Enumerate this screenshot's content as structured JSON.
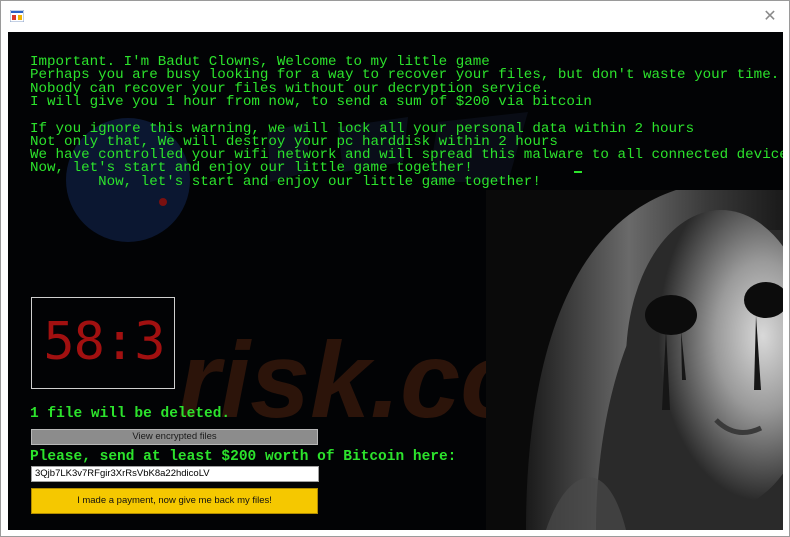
{
  "window": {
    "title": "",
    "close_glyph": "✕",
    "icon": "app-icon"
  },
  "message": {
    "lines": [
      "Important. I'm Badut Clowns, Welcome to my little game",
      "Perhaps you are busy looking for a way to recover your files, but don't waste your time.",
      "Nobody can recover your files without our decryption service.",
      "I will give you 1 hour from now, to send a sum of $200 via bitcoin",
      "",
      "If you ignore this warning, we will lock all your personal data within 2 hours",
      "Not only that, We will destroy your pc harddisk within 2 hours",
      "We have controlled your wifi network and will spread this malware to all connected devices",
      "Now, let's start and enjoy our little game together!",
      "        Now, let's start and enjoy our little game together!"
    ]
  },
  "timer": {
    "value": "58:3"
  },
  "status": {
    "deleted_text": "1 file will be deleted."
  },
  "buttons": {
    "view_label": "View encrypted files",
    "pay_label": "I made a payment, now give me back my files!"
  },
  "payment": {
    "prompt": "Please, send at least $200 worth of Bitcoin here:",
    "address": "3Qjb7LK3v7RFgir3XrRsVbK8a22hdicoLV"
  },
  "watermark": {
    "text": "risk.com"
  },
  "colors": {
    "text_green": "#2ce32c",
    "timer_red": "#a11010",
    "pay_button": "#f5c800",
    "background": "#020305"
  }
}
